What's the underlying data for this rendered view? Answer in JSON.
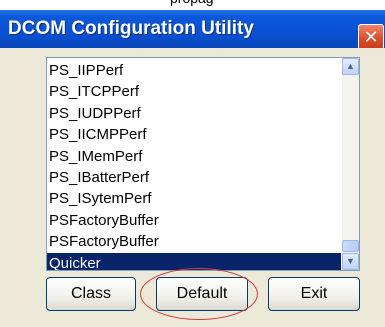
{
  "top_strip": {
    "text": "propag"
  },
  "window": {
    "title": "DCOM Configuration Utility",
    "close_glyph": "✕"
  },
  "listbox": {
    "items": [
      "PS_IIPPerf",
      "PS_ITCPPerf",
      "PS_IUDPPerf",
      "PS_IICMPPerf",
      "PS_IMemPerf",
      "PS_IBatterPerf",
      "PS_ISytemPerf",
      "PSFactoryBuffer",
      "PSFactoryBuffer",
      "Quicker"
    ],
    "selected_index": 9,
    "scroll_up_glyph": "▲",
    "scroll_down_glyph": "▼"
  },
  "buttons": {
    "class_label": "Class",
    "default_label": "Default",
    "exit_label": "Exit"
  },
  "annotation": {
    "color": "#d63b36"
  },
  "colors": {
    "titlebar": "#0a4fcf",
    "selection": "#0a246a",
    "client_bg": "#ece9d8"
  }
}
